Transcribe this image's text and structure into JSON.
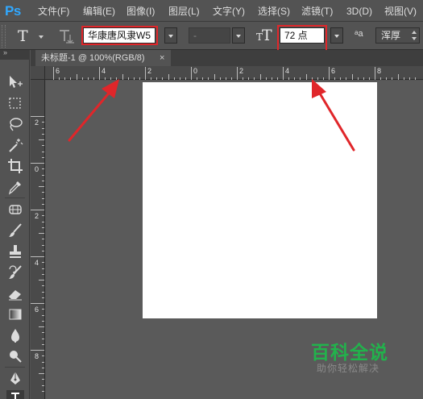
{
  "app": {
    "logo_text": "Ps",
    "accent": "#31a8ff"
  },
  "menu": [
    "文件(F)",
    "编辑(E)",
    "图像(I)",
    "图层(L)",
    "文字(Y)",
    "选择(S)",
    "滤镜(T)",
    "3D(D)",
    "视图(V)"
  ],
  "options_bar": {
    "tool_icon": "type-tool-icon",
    "orientation_icon": "text-orientation-icon",
    "font_family": "华康唐风隶W5",
    "font_style": "-",
    "font_size_icon": "font-size-icon",
    "font_size": "72 点",
    "antialias_icon": "antialias-icon",
    "antialias_label": "aa",
    "antialias_mode": "浑厚"
  },
  "document": {
    "tab_title": "未标题-1 @ 100%(RGB/8)",
    "close_glyph": "×",
    "canvas_color": "#ffffff",
    "pasteboard_color": "#5a5a5a"
  },
  "rulers": {
    "horizontal": [
      "6",
      "4",
      "2",
      "0",
      "2",
      "4",
      "6",
      "8"
    ],
    "vertical": [
      "2",
      "0",
      "2",
      "4",
      "6",
      "8"
    ]
  },
  "annotations": {
    "highlight_color": "#e0262a",
    "arrow_color": "#e0262a"
  },
  "watermark": {
    "main": "百科全说",
    "sub": "助你轻松解决",
    "color": "#22b24c"
  }
}
